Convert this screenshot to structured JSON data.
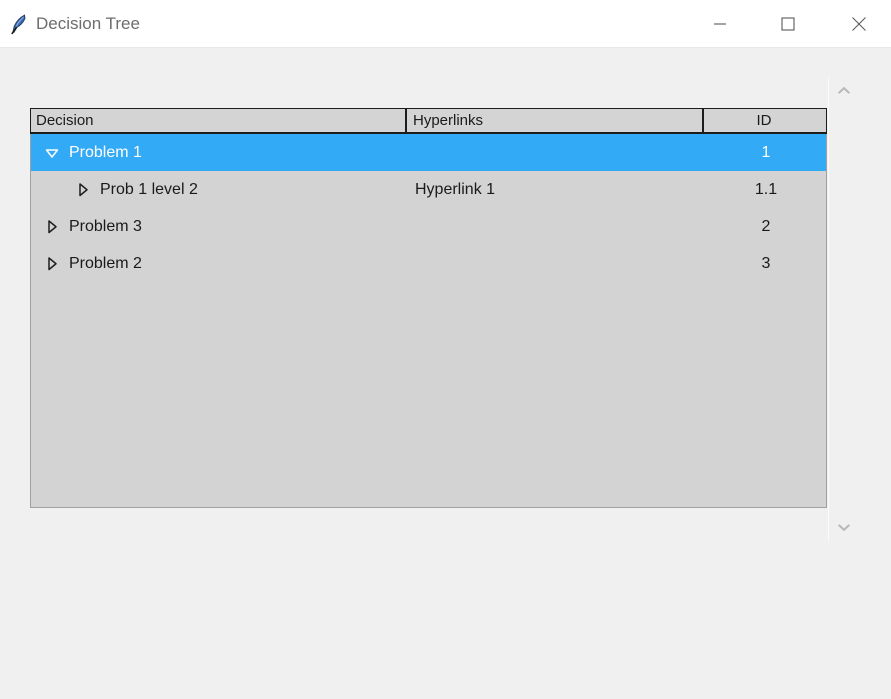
{
  "window": {
    "title": "Decision Tree",
    "icon": "feather-icon",
    "background_color": "#f0f0f0",
    "titlebar_color": "#ffffff",
    "controls": {
      "minimize_label": "Minimize",
      "maximize_label": "Maximize",
      "close_label": "Close"
    }
  },
  "scrollbar": {
    "up_label": "Scroll up",
    "down_label": "Scroll down"
  },
  "tree": {
    "selection_color": "#32aaf5",
    "body_color": "#d3d3d3",
    "columns": [
      {
        "key": "decision",
        "label": "Decision",
        "align": "left"
      },
      {
        "key": "hyperlinks",
        "label": "Hyperlinks",
        "align": "left"
      },
      {
        "key": "id",
        "label": "ID",
        "align": "center"
      }
    ],
    "rows": [
      {
        "decision": "Problem 1",
        "hyperlinks": "",
        "id": "1",
        "level": 0,
        "state": "expanded",
        "selected": true
      },
      {
        "decision": "Prob 1 level 2",
        "hyperlinks": "Hyperlink 1",
        "id": "1.1",
        "level": 1,
        "state": "collapsed",
        "selected": false
      },
      {
        "decision": "Problem 3",
        "hyperlinks": "",
        "id": "2",
        "level": 0,
        "state": "collapsed",
        "selected": false
      },
      {
        "decision": "Problem 2",
        "hyperlinks": "",
        "id": "3",
        "level": 0,
        "state": "collapsed",
        "selected": false
      }
    ]
  }
}
